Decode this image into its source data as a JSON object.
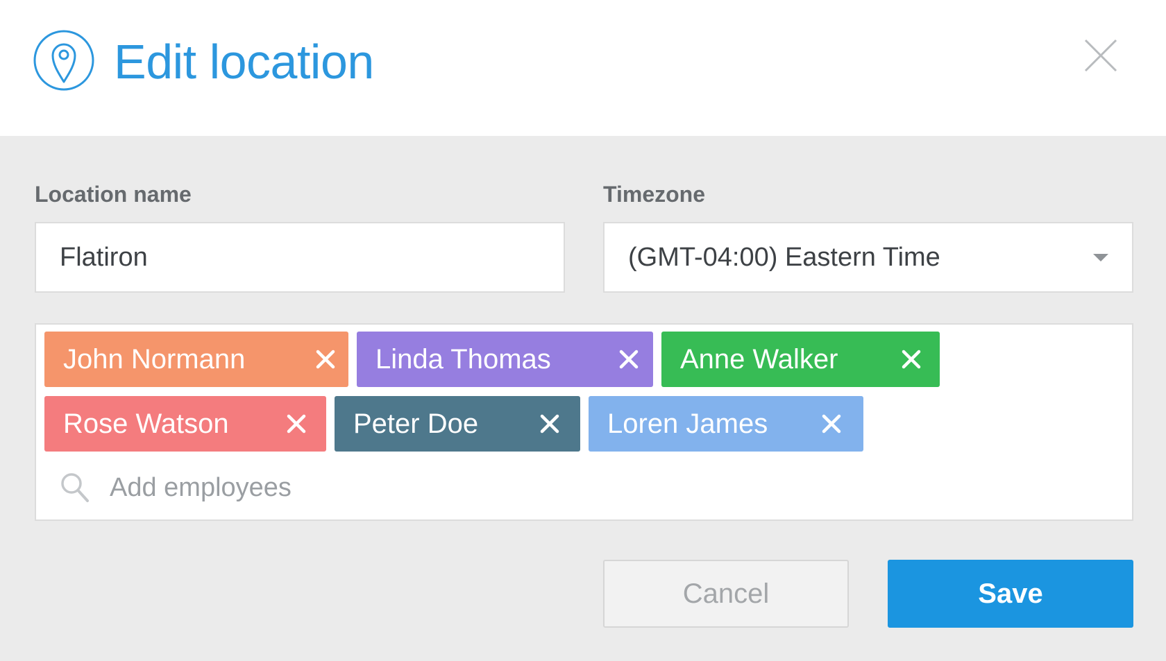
{
  "header": {
    "title": "Edit location",
    "icon": "location-pin-icon",
    "close_icon": "close-icon",
    "accent_color": "#2c97de"
  },
  "form": {
    "location_name_label": "Location name",
    "location_name_value": "Flatiron",
    "timezone_label": "Timezone",
    "timezone_value": "(GMT-04:00) Eastern Time"
  },
  "employees": {
    "chips": [
      {
        "name": "John Normann",
        "color": "#f5956b"
      },
      {
        "name": "Linda Thomas",
        "color": "#967ee0"
      },
      {
        "name": "Anne Walker",
        "color": "#37bc55"
      },
      {
        "name": "Rose Watson",
        "color": "#f47c7e"
      },
      {
        "name": "Peter Doe",
        "color": "#4e788c"
      },
      {
        "name": "Loren James",
        "color": "#82b2ed"
      }
    ],
    "add_placeholder": "Add employees",
    "search_icon": "search-icon"
  },
  "actions": {
    "cancel_label": "Cancel",
    "save_label": "Save",
    "save_color": "#1b95e0"
  }
}
